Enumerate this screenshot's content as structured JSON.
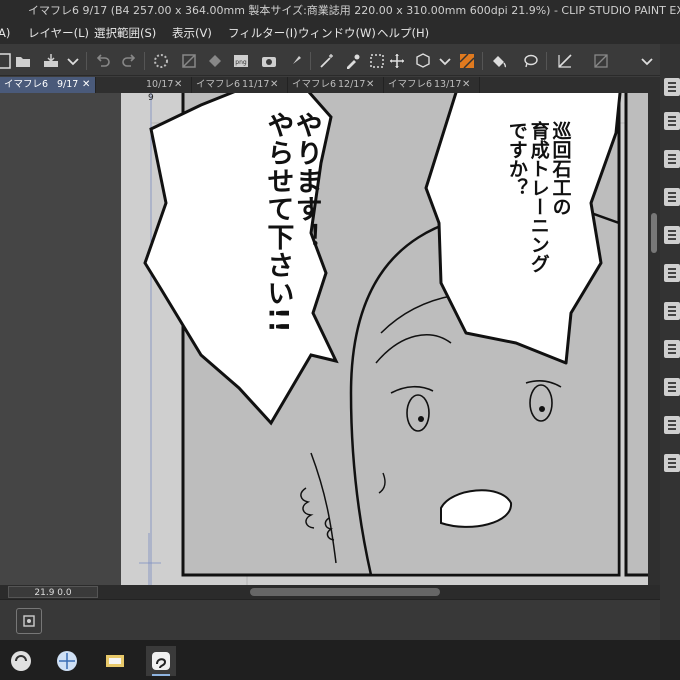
{
  "window": {
    "title": "イマフレ6 9/17 (B4 257.00 x 364.00mm 製本サイズ:商業誌用 220.00 x 310.00mm 600dpi 21.9%)  - CLIP STUDIO PAINT EX"
  },
  "menu": {
    "items": [
      "A)",
      "レイヤー(L)",
      "選択範囲(S)",
      "表示(V)",
      "フィルター(I)",
      "ウィンドウ(W)",
      "ヘルプ(H)"
    ]
  },
  "tabs": [
    {
      "name": "イマフレ6",
      "page": "9/17",
      "active": true
    },
    {
      "name": "",
      "page": "10/17",
      "active": false
    },
    {
      "name": "イマフレ6",
      "page": "11/17",
      "active": false
    },
    {
      "name": "イマフレ6",
      "page": "12/17",
      "active": false
    },
    {
      "name": "イマフレ6",
      "page": "13/17",
      "active": false
    }
  ],
  "canvas": {
    "page_number": "9",
    "balloon_left_lines": [
      "やります！",
      "やらせて下さい!!"
    ],
    "balloon_right_lines": [
      "巡回石工の",
      "育成トレーニング",
      "ですか？"
    ]
  },
  "status": {
    "zoom": "21.9",
    "rotation": "0.0"
  },
  "colors": {
    "accent_tab": "#4a5a7a",
    "ui_dark": "#2b2b2b",
    "canvas_gray": "#7a7a7a",
    "screentone": "#bdbdbd"
  }
}
